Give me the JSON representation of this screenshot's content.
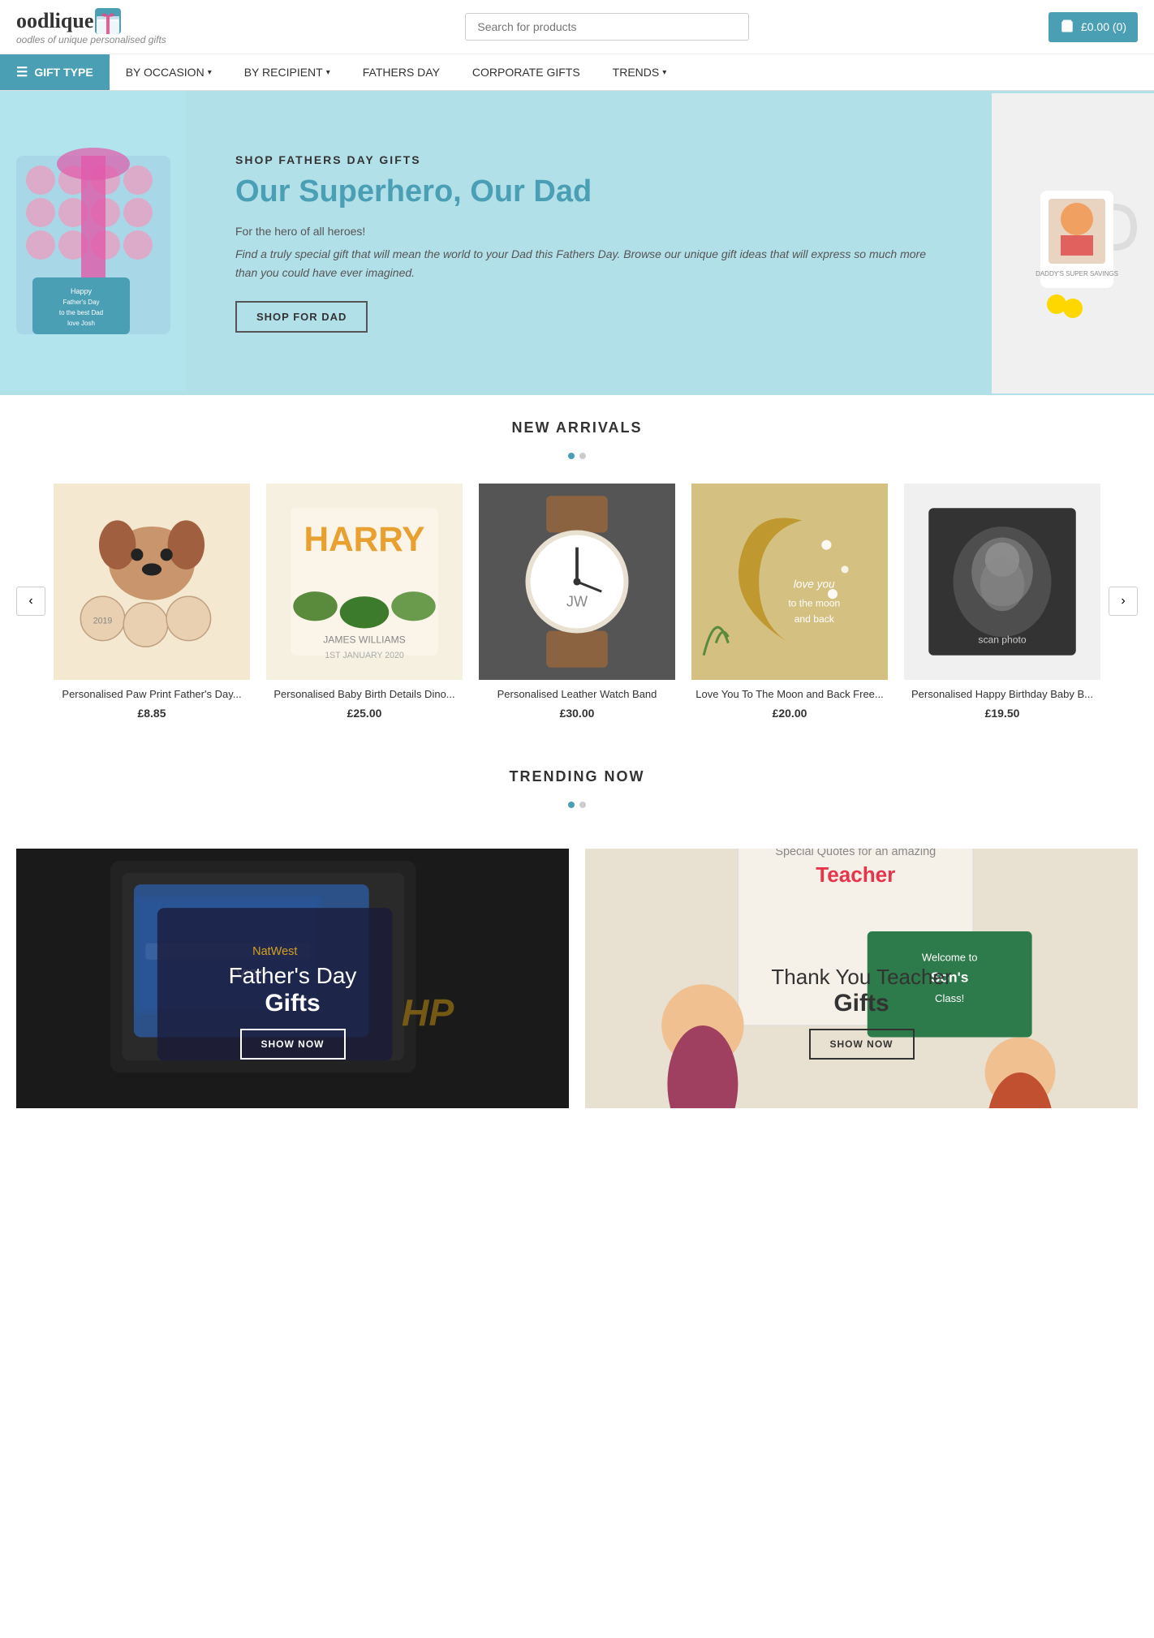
{
  "header": {
    "logo_text": "oodlique",
    "logo_subtitle": "oodles of unique personalised gifts",
    "search_placeholder": "Search for products",
    "cart_label": "£0.00 (0)"
  },
  "nav": {
    "gift_type_label": "GIFT TYPE",
    "items": [
      {
        "label": "BY OCCASION",
        "has_dropdown": true
      },
      {
        "label": "BY RECIPIENT",
        "has_dropdown": true
      },
      {
        "label": "FATHERS DAY",
        "has_dropdown": false
      },
      {
        "label": "CORPORATE GIFTS",
        "has_dropdown": false
      },
      {
        "label": "TRENDS",
        "has_dropdown": true
      }
    ]
  },
  "hero": {
    "subtitle": "SHOP FATHERS DAY GIFTS",
    "title": "Our Superhero, Our Dad",
    "tagline": "For the hero of all heroes!",
    "description": "Find a truly special gift that will mean the world to your Dad this Fathers Day. Browse our unique gift ideas that will express so much more than you could have ever imagined.",
    "cta_label": "SHOP FOR DAD"
  },
  "new_arrivals": {
    "section_title": "NEW ARRIVALS",
    "carousel_prev": "‹",
    "carousel_next": "›",
    "products": [
      {
        "name": "Personalised Paw Print Father's Day...",
        "price": "£8.85",
        "color": "#f5e8d0"
      },
      {
        "name": "Personalised Baby Birth Details Dino...",
        "price": "£25.00",
        "color": "#f5f0e0"
      },
      {
        "name": "Personalised Leather Watch Band",
        "price": "£30.00",
        "color": "#666"
      },
      {
        "name": "Love You To The Moon and Back Free...",
        "price": "£20.00",
        "color": "#c0a060"
      },
      {
        "name": "Personalised Happy Birthday Baby B...",
        "price": "£19.50",
        "color": "#f0f0f0"
      }
    ]
  },
  "trending": {
    "section_title": "TRENDING NOW"
  },
  "banners": [
    {
      "title_line1": "Father's Day",
      "title_line2": "Gifts",
      "cta_label": "SHOW NOW",
      "type": "wallet"
    },
    {
      "title_line1": "Thank You Teacher",
      "title_line2": "Gifts",
      "cta_label": "SHOW NOW",
      "type": "teacher"
    }
  ]
}
